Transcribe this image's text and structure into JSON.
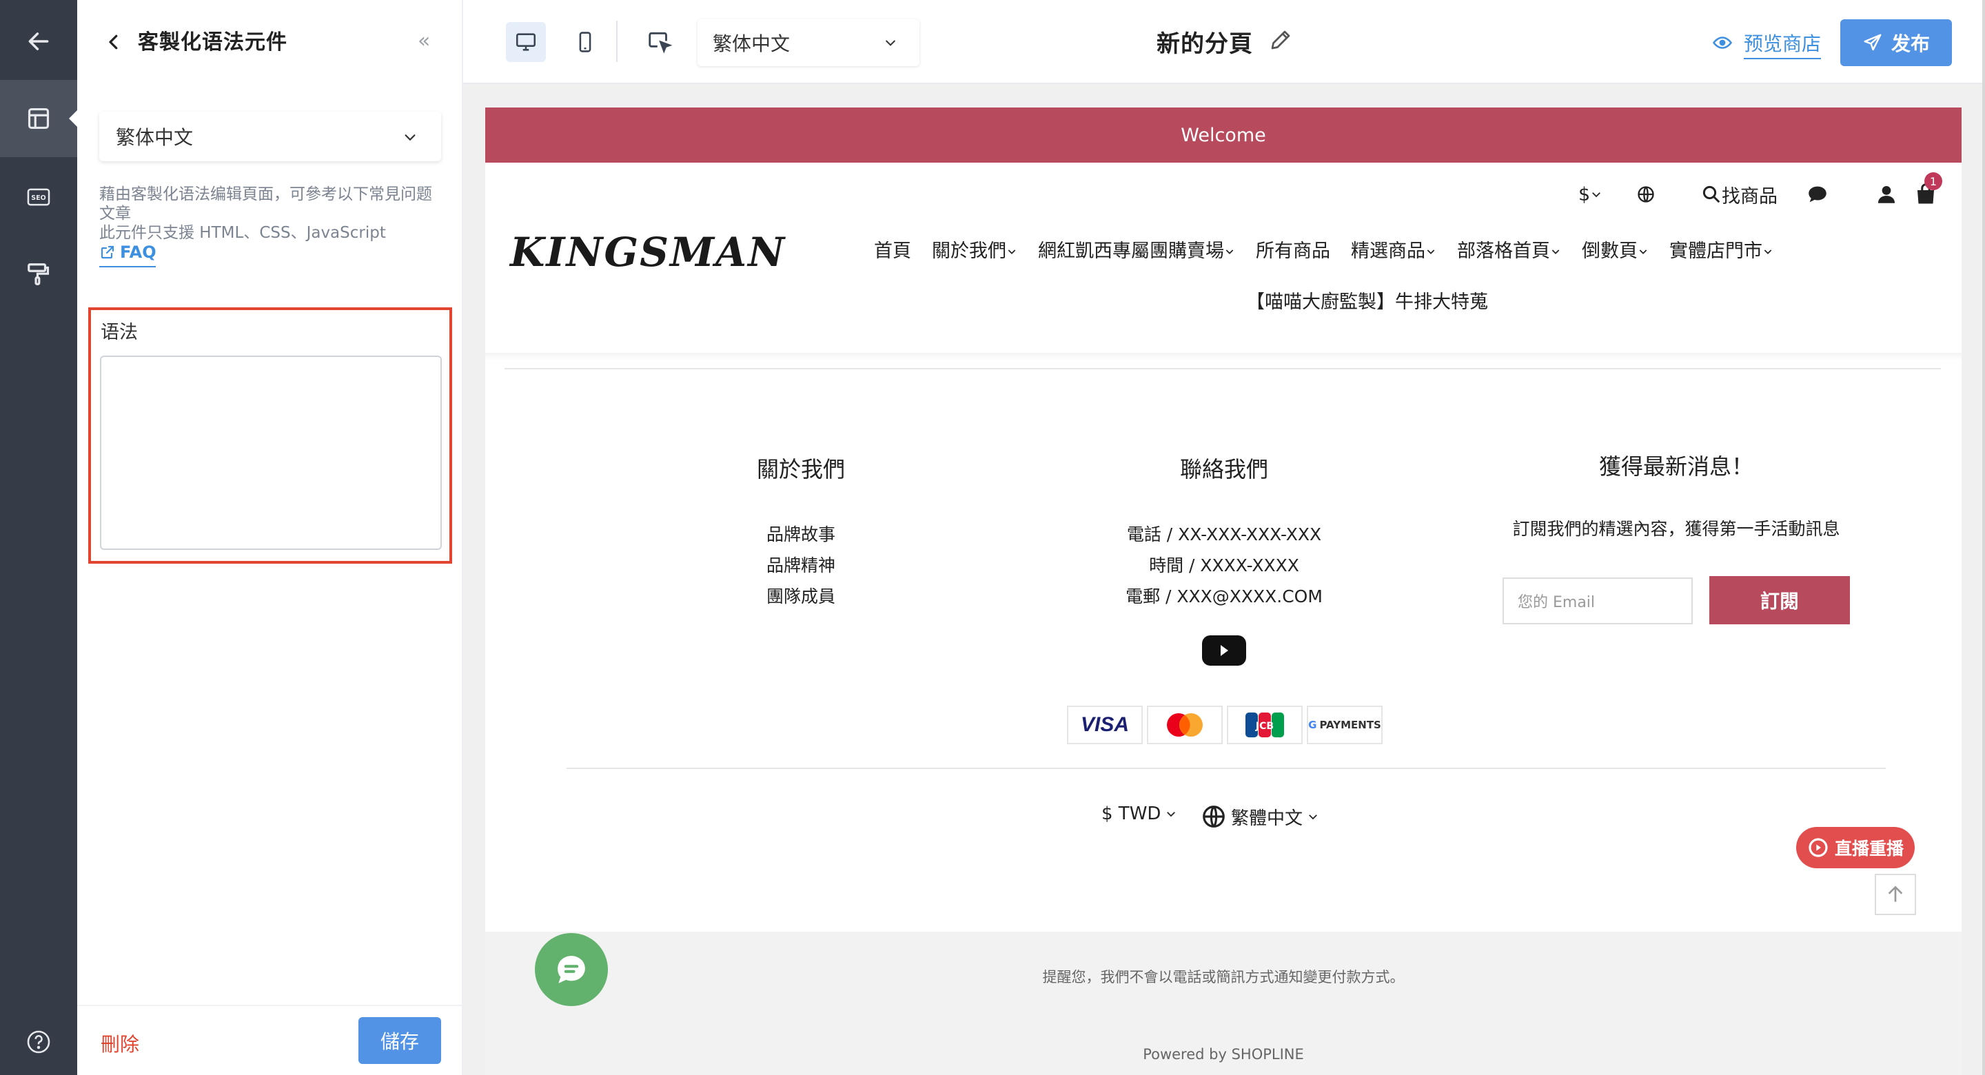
{
  "rail": {
    "items": [
      {
        "icon": "arrow-left-icon"
      },
      {
        "icon": "layout-icon",
        "active": true
      },
      {
        "icon": "seo-icon",
        "text": "SEO"
      },
      {
        "icon": "paint-roller-icon"
      },
      {
        "icon": "help-circle-icon"
      }
    ]
  },
  "panel": {
    "title": "客製化语法元件",
    "collapse_glyph": "«",
    "language": "繁体中文",
    "help_line1": "藉由客製化语法编辑頁面，可參考以下常見问题文章",
    "help_line2": "此元件只支援 HTML、CSS、JavaScript",
    "faq_label": "FAQ",
    "field_label": "语法",
    "field_value": "",
    "delete_label": "刪除",
    "save_label": "儲存"
  },
  "toolbar": {
    "language": "繁体中文",
    "page_name": "新的分頁",
    "preview_label": "预览商店",
    "publish_label": "发布"
  },
  "site": {
    "welcome": "Welcome",
    "currency_symbol": "$",
    "search_label": "找商品",
    "cart_count": "1",
    "logo": "KINGSMAN",
    "nav": [
      "首頁",
      "關於我們",
      "網紅凱西專屬團購賣場",
      "所有商品",
      "精選商品",
      "部落格首頁",
      "倒數頁",
      "實體店門市"
    ],
    "nav_dropdown": [
      false,
      true,
      true,
      false,
      true,
      true,
      true,
      true
    ],
    "nav_row2": "【喵喵大廚監製】牛排大特蒐",
    "footer": {
      "about_title": "關於我們",
      "about_items": [
        "品牌故事",
        "品牌精神",
        "團隊成員"
      ],
      "contact_title": "聯絡我們",
      "contact_items": [
        "電話 / XX-XXX-XXX-XXX",
        "時間 / XXXX-XXXX",
        "電郵 / XXX@XXXX.COM"
      ],
      "news_title": "獲得最新消息！",
      "news_desc": "訂閱我們的精選內容，獲得第一手活動訊息",
      "email_placeholder": "您的 Email",
      "subscribe_label": "訂閱",
      "payments": [
        "VISA",
        "Mastercard",
        "JCB",
        "PAYMENTS"
      ],
      "currency": "$ TWD",
      "site_language": "繁體中文",
      "live_label": "直播重播",
      "notice": "提醒您，我們不會以電話或簡訊方式通知變更付款方式。",
      "powered": "Powered by SHOPLINE"
    }
  },
  "colors": {
    "accent_blue": "#5393e6",
    "brand_red": "#b84a5e",
    "highlight": "#e2452f",
    "rail_bg": "#353c47",
    "chat_green": "#62b26d"
  }
}
